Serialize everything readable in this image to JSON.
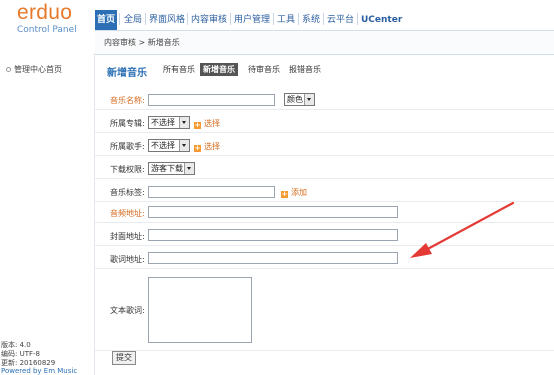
{
  "header": {
    "logo_word": "erduo",
    "logo_sub": "Control Panel",
    "nav": [
      "首页",
      "全局",
      "界面风格",
      "内容审核",
      "用户管理",
      "工具",
      "系统",
      "云平台",
      "UCenter"
    ]
  },
  "breadcrumb": "内容审核 > 新增音乐",
  "sidebar": {
    "item": "管理中心首页",
    "version": "版本: 4.0",
    "encoding": "编码: UTF-8",
    "updated": "更新: 20160829",
    "powered": "Powered by Em Music"
  },
  "subnav": {
    "title": "新增音乐",
    "tabs": [
      "所有音乐",
      "新增音乐",
      "待审音乐",
      "报错音乐"
    ]
  },
  "form": {
    "name_label": "音乐名称:",
    "color_select": "颜色",
    "album_label": "所属专辑:",
    "album_select": "不选择",
    "album_link": "选择",
    "singer_label": "所属歌手:",
    "singer_select": "不选择",
    "singer_link": "选择",
    "download_label": "下载权限:",
    "download_select": "游客下载",
    "tag_label": "音乐标签:",
    "tag_link": "添加",
    "audio_label": "音频地址:",
    "cover_label": "封面地址:",
    "lyric_label": "歌词地址:",
    "text_lyric_label": "文本歌词:",
    "submit": "提交"
  },
  "colors": {
    "accent": "#2c6fb4",
    "orange": "#e8792b",
    "annotation_arrow": "#e53935"
  }
}
